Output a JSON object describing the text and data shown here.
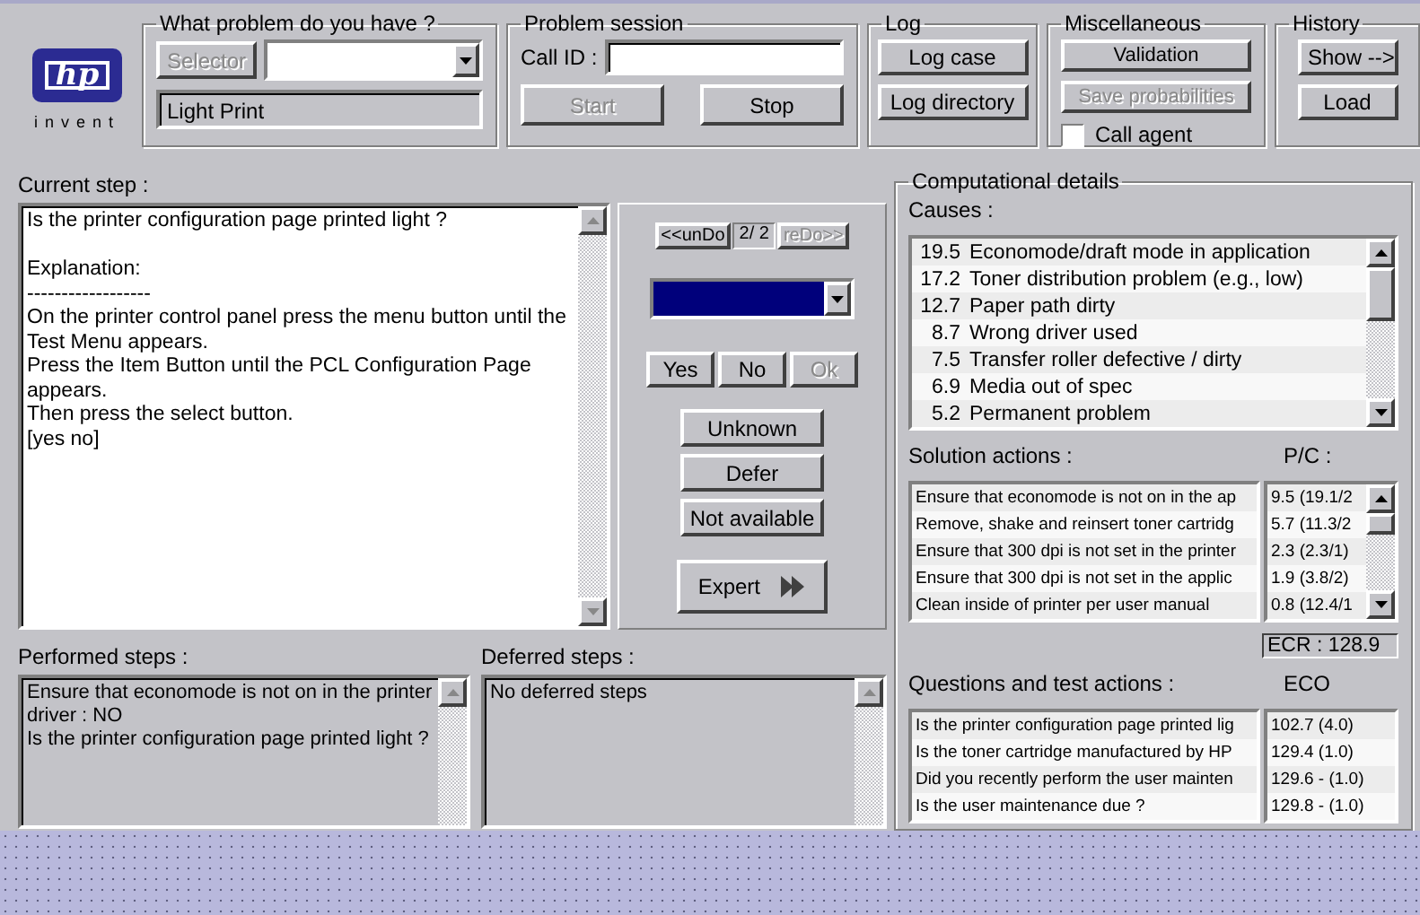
{
  "logo": {
    "brand": "hp",
    "tagline": "invent"
  },
  "problem": {
    "title": "What problem do you have ?",
    "selector": {
      "label": "Selector",
      "disabled": true
    },
    "selected_problem": "Light Print"
  },
  "session": {
    "title": "Problem session",
    "call_id_label": "Call ID :",
    "buttons": [
      {
        "label": "Start",
        "disabled": true
      },
      {
        "label": "Stop",
        "disabled": false
      }
    ]
  },
  "log": {
    "title": "Log",
    "buttons": [
      {
        "label": "Log case",
        "disabled": false
      },
      {
        "label": "Log directory",
        "disabled": false
      }
    ]
  },
  "misc": {
    "title": "Miscellaneous",
    "buttons": [
      {
        "label": "Validation",
        "disabled": false
      },
      {
        "label": "Save probabilities",
        "disabled": true
      }
    ],
    "call_agent": {
      "label": "Call agent",
      "checked": false
    }
  },
  "history": {
    "title": "History",
    "buttons": [
      {
        "label": "Show -->",
        "disabled": false
      },
      {
        "label": "Load",
        "disabled": false
      }
    ]
  },
  "current_step": {
    "label": "Current step :",
    "question": "Is the printer configuration page printed light ?",
    "explanation": [
      "Explanation:",
      "------------------",
      "On the printer control panel press the menu button until the Test Menu appears.",
      "Press the Item Button until the PCL Configuration Page appears.",
      "Then press the select button.",
      "[yes  no]"
    ]
  },
  "navigation": {
    "undo": {
      "label": "<<unDo",
      "disabled": false
    },
    "counter": "2/ 2",
    "redo": {
      "label": "reDo>>",
      "disabled": true
    }
  },
  "answer_buttons": [
    {
      "label": "Yes",
      "disabled": false
    },
    {
      "label": "No",
      "disabled": false
    },
    {
      "label": "Ok",
      "disabled": true
    }
  ],
  "other_buttons": [
    {
      "label": "Unknown"
    },
    {
      "label": "Defer"
    },
    {
      "label": "Not available"
    }
  ],
  "expert_button": {
    "label": "Expert"
  },
  "performed": {
    "label": "Performed steps :",
    "lines": [
      "Ensure that economode is not on in the printer driver : NO",
      "Is the printer configuration page printed light ?"
    ]
  },
  "deferred": {
    "label": "Deferred steps :",
    "lines": [
      "No deferred steps"
    ]
  },
  "computational": {
    "title": "Computational details",
    "causes": {
      "label": "Causes :",
      "rows": [
        {
          "value": "19.5",
          "name": "Economode/draft mode in application"
        },
        {
          "value": "17.2",
          "name": "Toner distribution problem (e.g., low)"
        },
        {
          "value": "12.7",
          "name": "Paper path dirty"
        },
        {
          "value": "8.7",
          "name": "Wrong driver used"
        },
        {
          "value": "7.5",
          "name": "Transfer roller defective / dirty"
        },
        {
          "value": "6.9",
          "name": "Media out of spec"
        },
        {
          "value": "5.2",
          "name": "Permanent problem"
        }
      ]
    },
    "solutions": {
      "label": "Solution actions :",
      "pc_label": "P/C :",
      "rows": [
        {
          "action": "Ensure that economode is not on in the ap",
          "pc": "9.5 (19.1/2"
        },
        {
          "action": "Remove, shake and reinsert toner cartridg",
          "pc": "5.7 (11.3/2"
        },
        {
          "action": "Ensure that 300 dpi is not set in the printer",
          "pc": "2.3 (2.3/1)"
        },
        {
          "action": "Ensure that 300 dpi is not set in the applic",
          "pc": "1.9 (3.8/2)"
        },
        {
          "action": "Clean inside of printer per user manual",
          "pc": "0.8 (12.4/1"
        }
      ],
      "ecr": "ECR : 128.9"
    },
    "questions": {
      "label": "Questions and test actions :",
      "eco_label": "ECO",
      "rows": [
        {
          "question": "Is the printer configuration page printed lig",
          "eco": "102.7  (4.0)"
        },
        {
          "question": "Is the toner cartridge manufactured by HP",
          "eco": "129.4  (1.0)"
        },
        {
          "question": "Did you recently perform the user mainten",
          "eco": "129.6 - (1.0)"
        },
        {
          "question": "Is the user maintenance due ?",
          "eco": "129.8 - (1.0)"
        }
      ]
    }
  }
}
